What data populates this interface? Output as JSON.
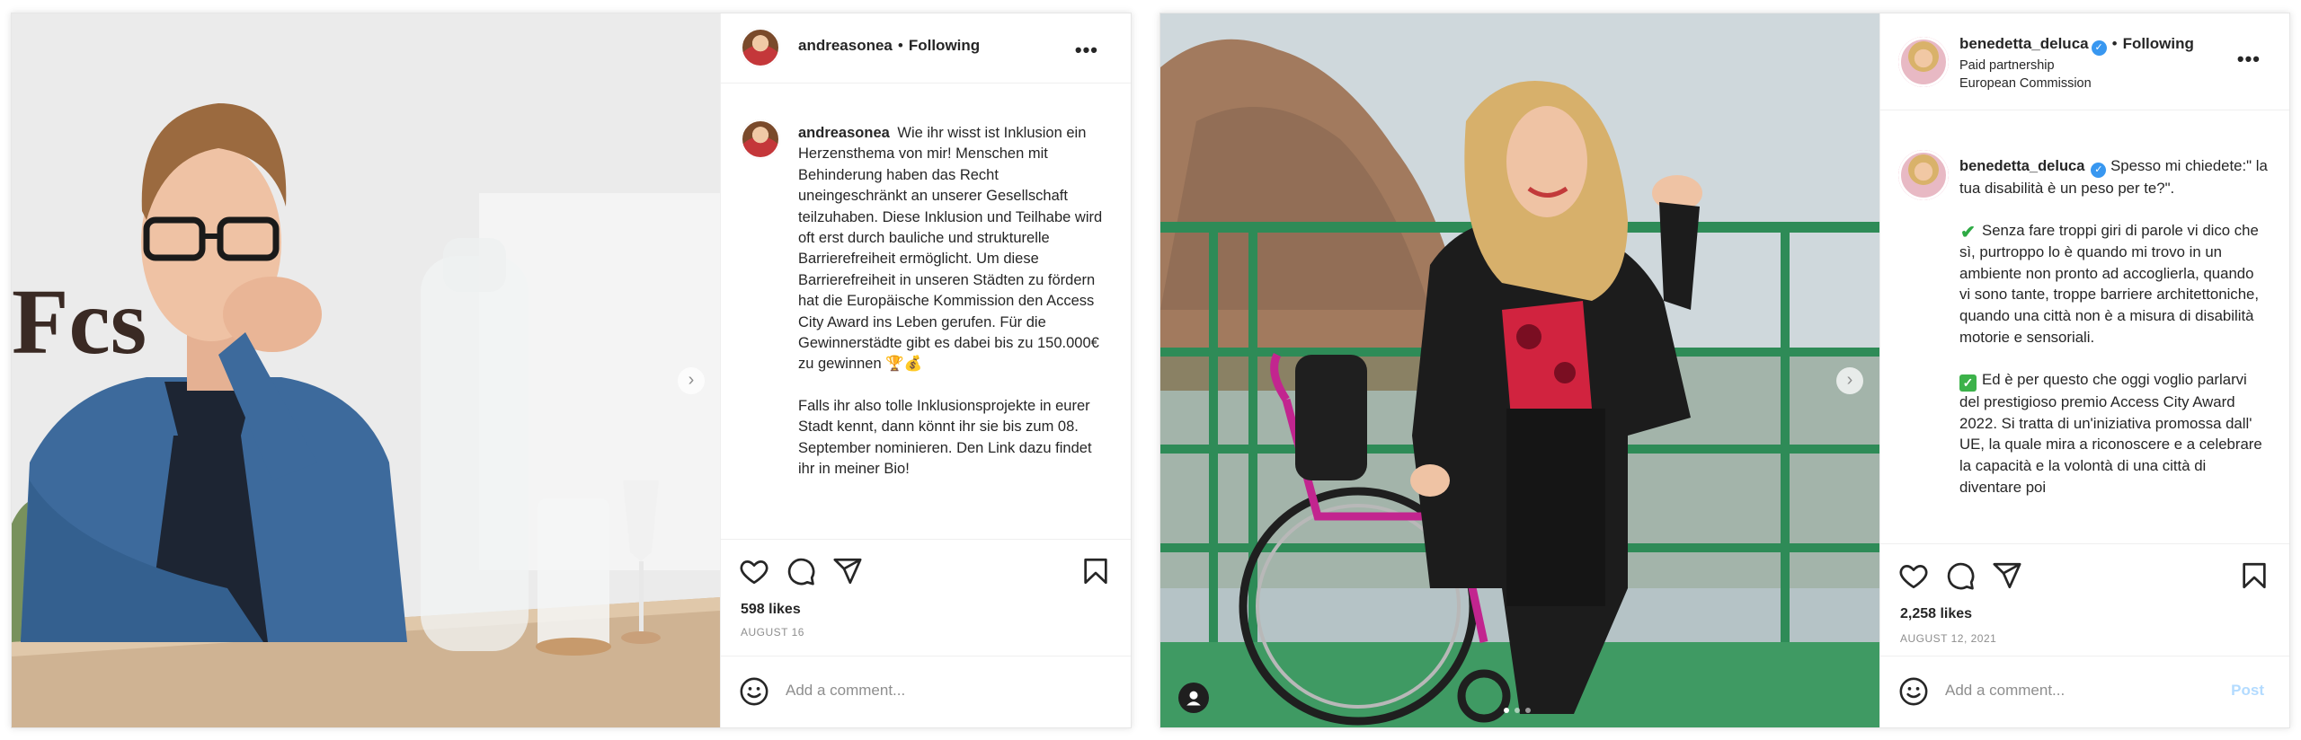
{
  "post1": {
    "username": "andreasonea",
    "separator": "•",
    "following": "Following",
    "more": "•••",
    "photo_sign": "Fcs",
    "caption": {
      "username": "andreasonea",
      "paragraph1": "Wie ihr wisst ist Inklusion ein Herzensthema von mir! Menschen mit Behinderung haben das Recht uneingeschränkt an unserer Gesellschaft teilzuhaben. Diese Inklusion und Teilhabe wird oft erst durch bauliche und strukturelle Barrierefreiheit ermöglicht. Um diese Barrierefreiheit in unseren Städten zu fördern hat die Europäische Kommission den Access City Award ins Leben gerufen. Für die Gewinnerstädte gibt es dabei bis zu 150.000€ zu gewinnen 🏆💰",
      "paragraph2": "Falls ihr also tolle Inklusionsprojekte in eurer Stadt kennt, dann könnt ihr sie bis zum 08. September nominieren. Den Link dazu findet ihr in meiner Bio!"
    },
    "likes": "598 likes",
    "date": "AUGUST 16",
    "comment_placeholder": "Add a comment...",
    "icons": [
      "heart-icon",
      "comment-icon",
      "share-icon",
      "bookmark-icon",
      "smile-icon",
      "chevron-right-icon"
    ]
  },
  "post2": {
    "username": "benedetta_deluca",
    "separator": "•",
    "following": "Following",
    "paid_partnership": "Paid partnership",
    "partner": "European Commission",
    "more": "•••",
    "caption": {
      "username": "benedetta_deluca",
      "paragraph1": "Spesso mi chiedete:\" la tua disabilità è un peso per te?\".",
      "check1": "✔",
      "paragraph2": "Senza fare troppi giri di parole vi dico che sì, purtroppo lo è quando mi trovo in un ambiente non pronto ad accoglierla, quando vi sono tante, troppe barriere architettoniche, quando una città non è a misura di disabilità motorie e sensoriali.",
      "check2": "✓",
      "paragraph3": "Ed è per questo che oggi voglio parlarvi del prestigioso premio Access City Award 2022. Si tratta di un'iniziativa promossa dall' UE, la quale mira a riconoscere e a celebrare la capacità e la volontà di una città di diventare poi"
    },
    "likes": "2,258 likes",
    "date": "AUGUST 12, 2021",
    "comment_placeholder": "Add a comment...",
    "post_label": "Post",
    "icons": [
      "heart-icon",
      "comment-icon",
      "share-icon",
      "bookmark-icon",
      "smile-icon",
      "chevron-right-icon",
      "user-tag-icon"
    ]
  },
  "colors": {
    "accent_blue": "#3897f0",
    "post_button_disabled": "#b3dbff",
    "muted_text": "#8e8e8e",
    "text": "#262626",
    "railing_green": "#2e8b57",
    "wheelchair_magenta": "#c2258f"
  }
}
